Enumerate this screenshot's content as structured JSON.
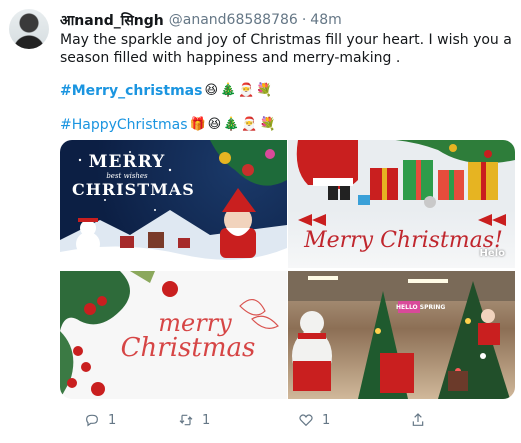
{
  "tweet": {
    "display_name": "आnand_सिngh",
    "handle": "@anand68588786",
    "separator": "·",
    "timestamp": "48m",
    "text": "May the sparkle and joy of Christmas fill your heart. I wish you a season filled with happiness and merry-making .",
    "hashtag1": "#Merry_christmas",
    "hashtag1_emojis": [
      "😆",
      "🎄",
      "🎅",
      "💐"
    ],
    "hashtag2": "#HappyChristmas",
    "hashtag2_emojis": [
      "🎁",
      "😆",
      "🎄",
      "🎅",
      "💐"
    ],
    "images": [
      {
        "name": "christmas-image-1",
        "overlay": "MERRY",
        "overlay_sub": "best wishes",
        "overlay2": "CHRISTMAS"
      },
      {
        "name": "christmas-image-2",
        "overlay": "Merry Christmas!",
        "watermark": "Helo"
      },
      {
        "name": "christmas-image-3",
        "overlay": "merry",
        "overlay2": "Christmas"
      },
      {
        "name": "christmas-image-4",
        "overlay": "HELLO SPRING"
      }
    ],
    "actions": {
      "reply_count": "1",
      "retweet_count": "1",
      "like_count": "1"
    }
  },
  "colors": {
    "link": "#1b95e0",
    "muted": "#657786",
    "text": "#14171a"
  }
}
